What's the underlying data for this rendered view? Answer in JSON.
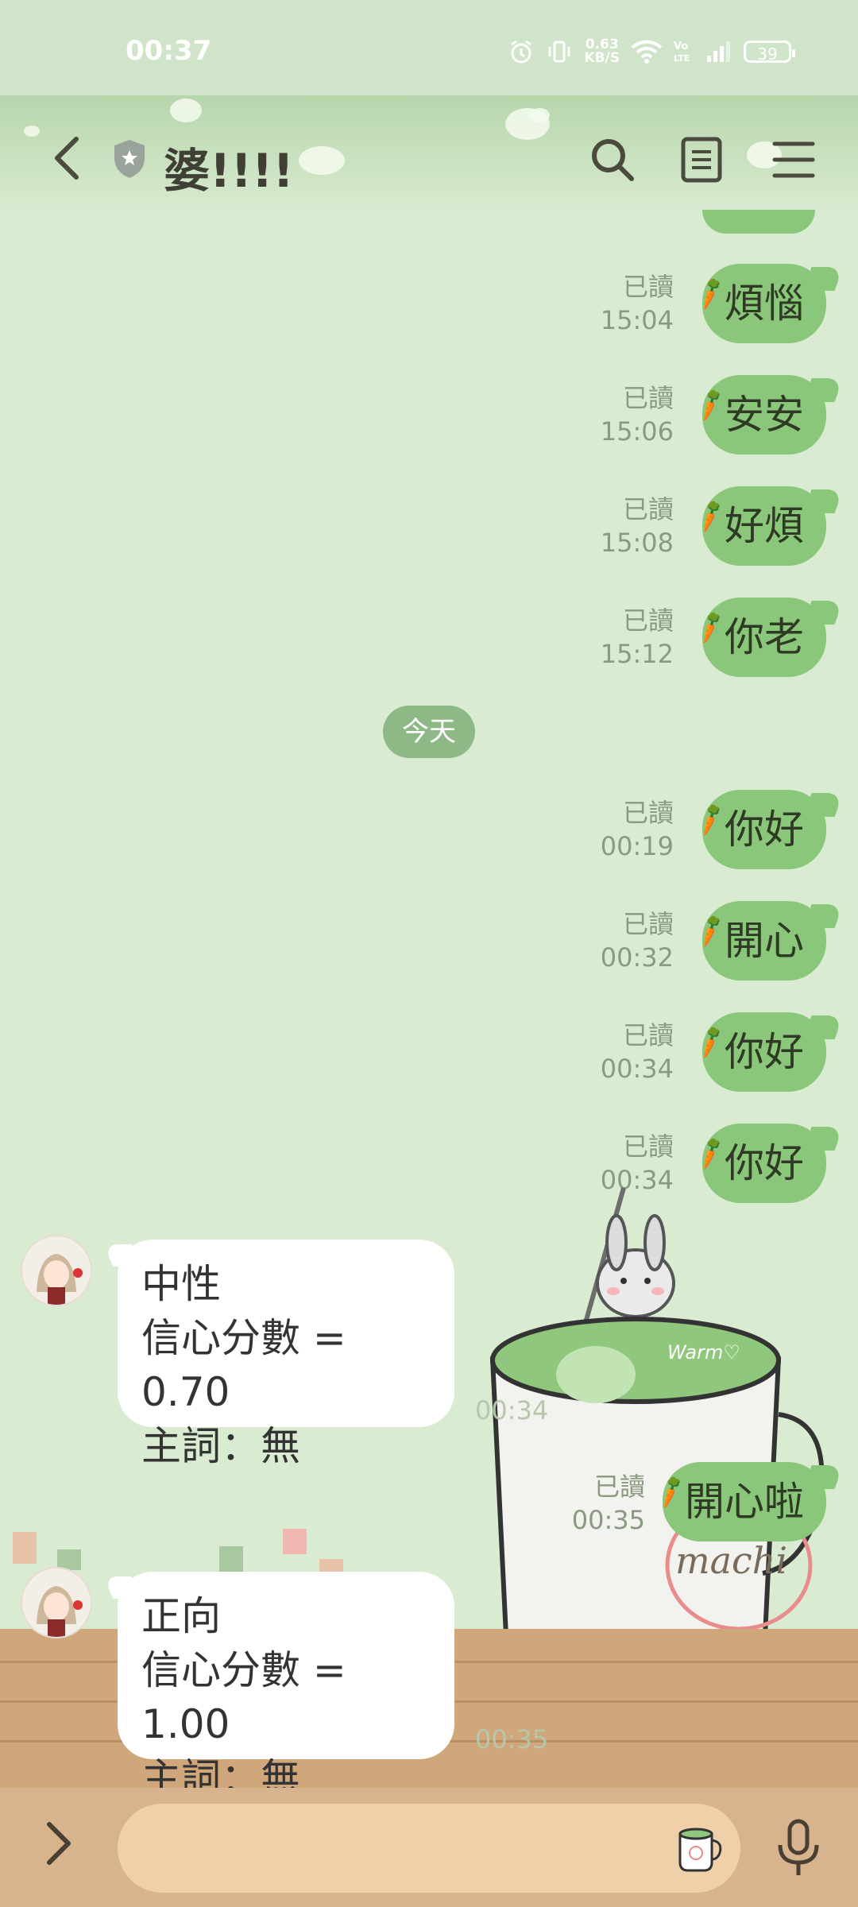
{
  "status_bar": {
    "time": "00:37",
    "net_speed_value": "0.63",
    "net_speed_unit": "KB/S",
    "battery": "39"
  },
  "header": {
    "title": "婆!!!!"
  },
  "date_separator": "今天",
  "outgoing_messages": [
    {
      "text": "煩惱",
      "read": "已讀",
      "time": "15:04"
    },
    {
      "text": "安安",
      "read": "已讀",
      "time": "15:06"
    },
    {
      "text": "好煩",
      "read": "已讀",
      "time": "15:08"
    },
    {
      "text": "你老",
      "read": "已讀",
      "time": "15:12"
    },
    {
      "text": "你好",
      "read": "已讀",
      "time": "00:19"
    },
    {
      "text": "開心",
      "read": "已讀",
      "time": "00:32"
    },
    {
      "text": "你好",
      "read": "已讀",
      "time": "00:34"
    },
    {
      "text": "你好",
      "read": "已讀",
      "time": "00:34"
    },
    {
      "text": "開心啦",
      "read": "已讀",
      "time": "00:35"
    }
  ],
  "incoming_messages": [
    {
      "line1": "中性",
      "line2": "信心分數 = 0.70",
      "line3": "主詞：無",
      "time": "00:34"
    },
    {
      "line1": "正向",
      "line2": "信心分數 = 1.00",
      "line3": "主詞：無",
      "time": "00:35"
    }
  ],
  "background_art": {
    "mug_text": "machi",
    "latte_text": "Warm♡"
  },
  "input": {
    "value": "",
    "placeholder": ""
  },
  "colors": {
    "outgoing_bubble": "#8bc77a",
    "incoming_bubble": "#ffffff",
    "chat_background": "#d9ecd2",
    "input_bar": "#d8b48e"
  }
}
